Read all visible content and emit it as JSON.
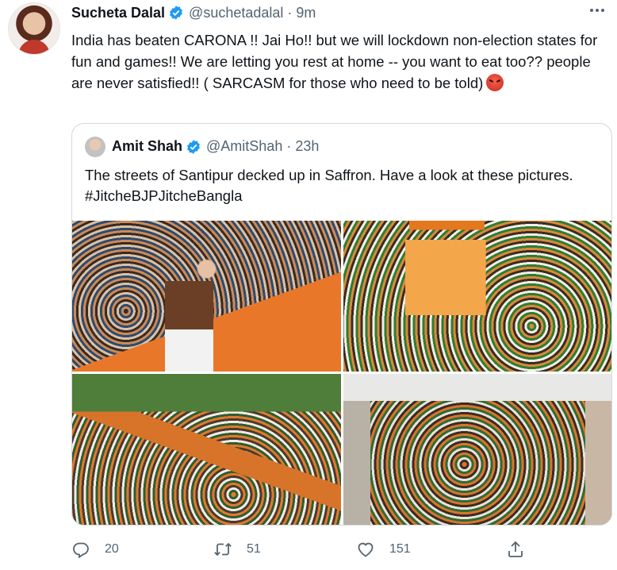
{
  "tweet": {
    "name": "Sucheta Dalal",
    "handle": "@suchetadalal",
    "separator": "·",
    "time": "9m",
    "text": "India has beaten CARONA !! Jai Ho!! but we will lockdown non-election states for fun and games!! We are letting  you rest at home -- you want to eat too?? people are never satisfied!! ( SARCASM for those who need to be told)",
    "emoji": "angry-face"
  },
  "quoted": {
    "name": "Amit Shah",
    "handle": "@AmitShah",
    "separator": "·",
    "time": "23h",
    "text": "The streets of Santipur decked up in Saffron. Have a look at these pictures. #JitcheBJPJitcheBangla"
  },
  "actions": {
    "replies": "20",
    "retweets": "51",
    "likes": "151"
  },
  "colors": {
    "accent": "#1d9bf0",
    "secondary_text": "#536471",
    "border": "#cfd9de"
  }
}
